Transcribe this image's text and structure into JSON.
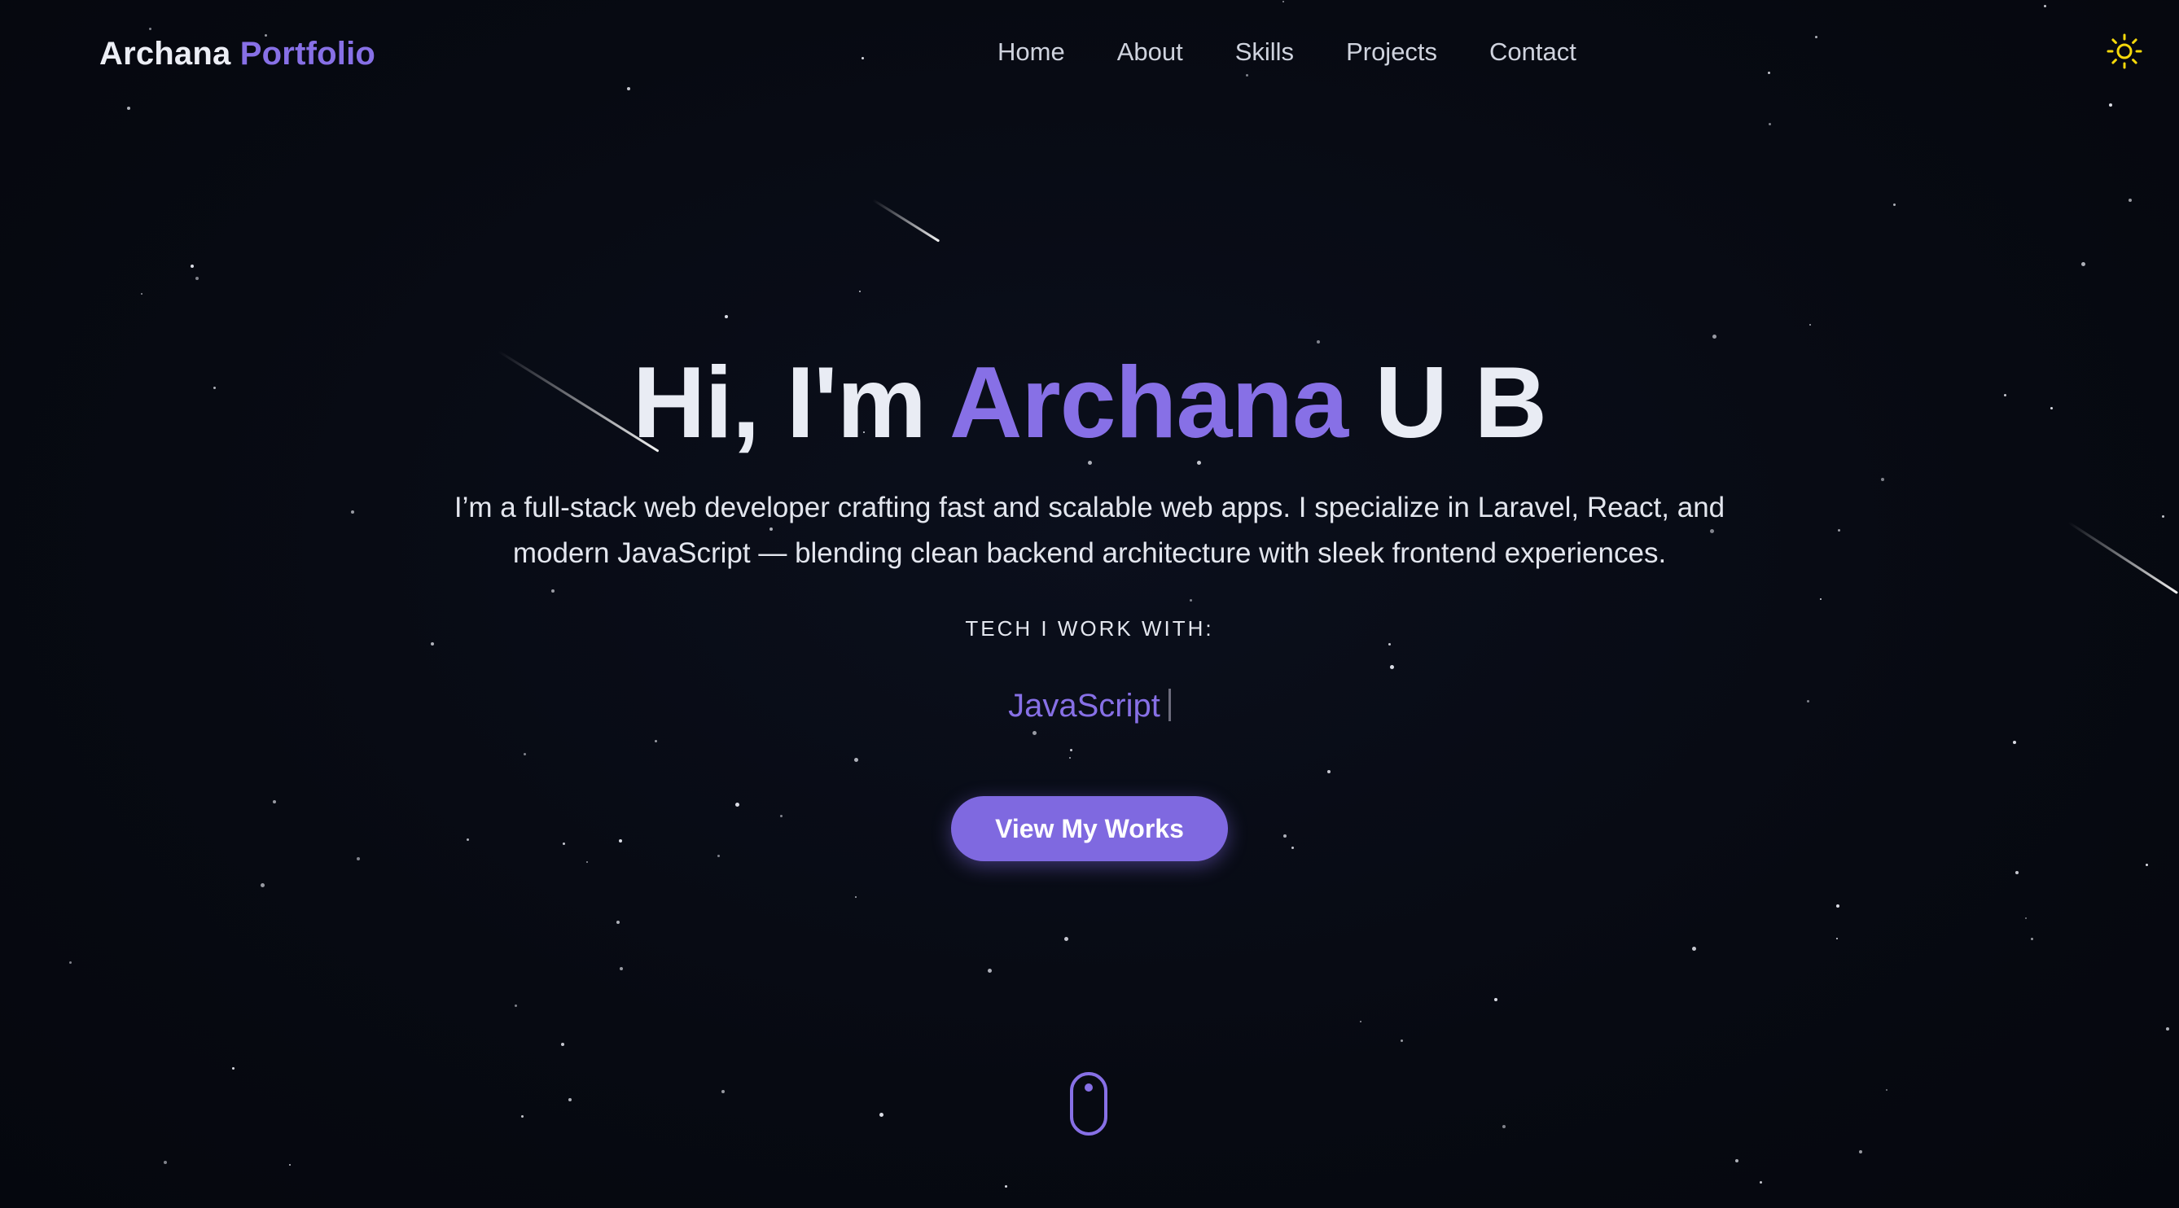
{
  "header": {
    "brand_first": "Archana",
    "brand_second": "Portfolio",
    "nav": {
      "home": "Home",
      "about": "About",
      "skills": "Skills",
      "projects": "Projects",
      "contact": "Contact"
    },
    "theme_toggle_icon": "sun-icon"
  },
  "hero": {
    "greeting": "Hi, I'm",
    "name_highlight": "Archana",
    "name_rest": "U B",
    "description": "I’m a full-stack web developer crafting fast and scalable web apps. I specialize in Laravel, React, and modern JavaScript — blending clean backend architecture with sleek frontend experiences.",
    "tech_label": "TECH I WORK WITH:",
    "tech_current": "JavaScript",
    "cta_label": "View My Works",
    "scroll_icon": "mouse-scroll-icon"
  },
  "colors": {
    "background": "#070a12",
    "accent": "#8770e6",
    "text": "#e9ecf4",
    "sun": "#f5d90a"
  }
}
